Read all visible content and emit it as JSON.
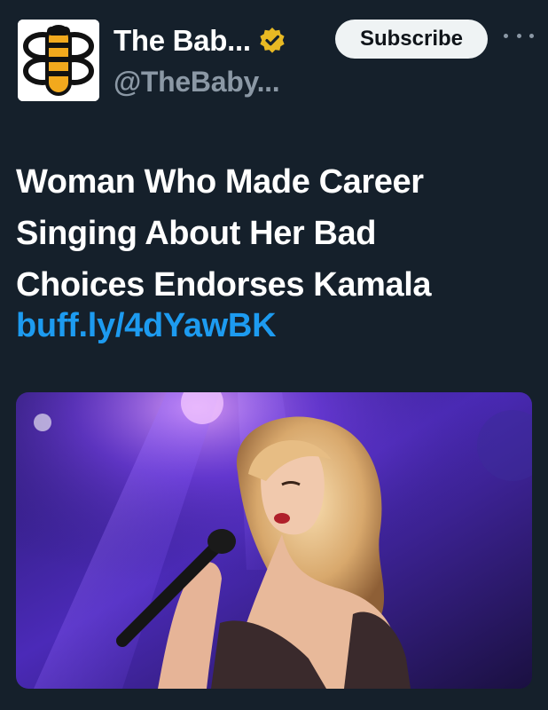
{
  "account": {
    "display_name": "The Bab...",
    "handle": "@TheBaby...",
    "verified": true,
    "avatar_icon": "bee-logo-icon",
    "badge_color": "#e8b923"
  },
  "actions": {
    "subscribe_label": "Subscribe",
    "more_icon": "more-horizontal-icon"
  },
  "post": {
    "headline_lines": [
      "Woman Who Made Career",
      "Singing About Her Bad",
      "Choices Endorses Kamala"
    ],
    "link_text": "buff.ly/4dYawBK"
  },
  "media": {
    "type": "photo",
    "alt": ""
  },
  "colors": {
    "background": "#15202b",
    "text": "#ffffff",
    "secondary_text": "#8b98a5",
    "link": "#1d9bf0",
    "button_bg": "#eff3f4"
  }
}
